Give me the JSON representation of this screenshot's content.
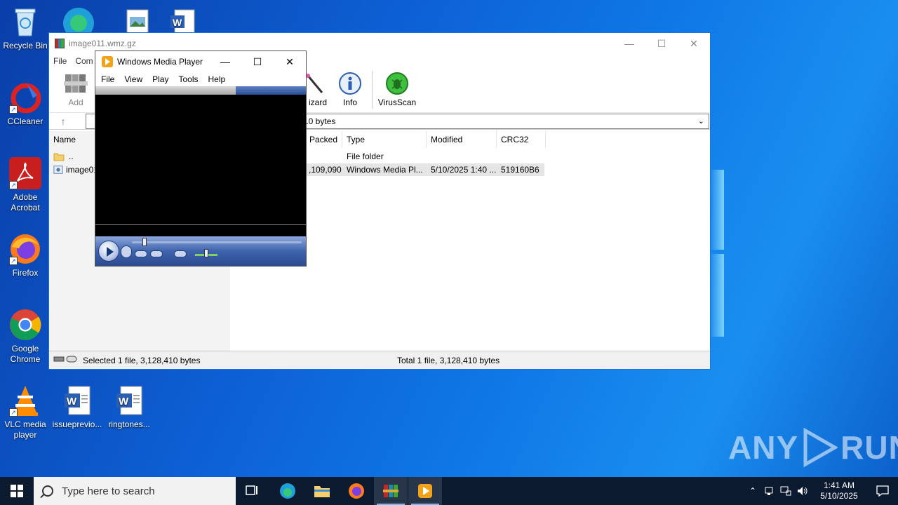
{
  "desktop": {
    "icons": [
      {
        "label": "Recycle Bin"
      },
      {
        "label": "CCleaner"
      },
      {
        "label": "Adobe Acrobat"
      },
      {
        "label": "Firefox"
      },
      {
        "label": "Google Chrome"
      },
      {
        "label": "VLC media player"
      },
      {
        "label": "issueprevio..."
      },
      {
        "label": "ringtones..."
      }
    ]
  },
  "winrar": {
    "title": "image011.wmz.gz",
    "menu": [
      "File",
      "Com"
    ],
    "toolbar": {
      "add": "Add",
      "wizard": "izard",
      "info": "Info",
      "virusscan": "VirusScan"
    },
    "path_text": "10 bytes",
    "columns": {
      "name": "Name",
      "packed": "Packed",
      "type": "Type",
      "modified": "Modified",
      "crc32": "CRC32"
    },
    "rows": [
      {
        "name": "..",
        "packed": "",
        "type": "File folder",
        "modified": "",
        "crc32": ""
      },
      {
        "name": "image01",
        "packed": ",109,090",
        "type": "Windows Media Pl...",
        "modified": "5/10/2025 1:40 ...",
        "crc32": "519160B6"
      }
    ],
    "status_left": "Selected 1 file, 3,128,410 bytes",
    "status_right": "Total 1 file, 3,128,410 bytes",
    "accent": "#1c73d8"
  },
  "wmp": {
    "title": "Windows Media Player",
    "menu": [
      "File",
      "View",
      "Play",
      "Tools",
      "Help"
    ],
    "seek_fraction": 0.06,
    "volume_fraction": 0.5
  },
  "taskbar": {
    "search_placeholder": "Type here to search",
    "time": "1:41 AM",
    "date": "5/10/2025"
  },
  "watermark": {
    "left": "ANY",
    "right": "RUN"
  }
}
